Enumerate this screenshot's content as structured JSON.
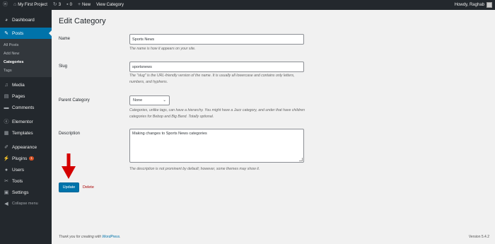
{
  "adminbar": {
    "site_name": "My First Project",
    "updates_count": "3",
    "comments_count": "0",
    "new_label": "New",
    "view_category": "View Category",
    "howdy": "Howdy, Raghab"
  },
  "sidebar": {
    "dashboard": "Dashboard",
    "posts": "Posts",
    "posts_sub": [
      "All Posts",
      "Add New",
      "Categories",
      "Tags"
    ],
    "media": "Media",
    "pages": "Pages",
    "comments": "Comments",
    "elementor": "Elementor",
    "templates": "Templates",
    "appearance": "Appearance",
    "plugins": "Plugins",
    "plugins_badge": "1",
    "users": "Users",
    "tools": "Tools",
    "settings": "Settings",
    "collapse": "Collapse menu"
  },
  "page": {
    "title": "Edit Category"
  },
  "form": {
    "name_label": "Name",
    "name_value": "Sports News",
    "name_desc": "The name is how it appears on your site.",
    "slug_label": "Slug",
    "slug_value": "sportsnews",
    "slug_desc": "The \"slug\" is the URL-friendly version of the name. It is usually all lowercase and contains only letters, numbers, and hyphens.",
    "parent_label": "Parent Category",
    "parent_value": "None",
    "parent_desc": "Categories, unlike tags, can have a hierarchy. You might have a Jazz category, and under that have children categories for Bebop and Big Band. Totally optional.",
    "description_label": "Description",
    "description_value": "Making changes to Sports News categories",
    "description_desc": "The description is not prominent by default; however, some themes may show it.",
    "update_label": "Update",
    "delete_label": "Delete"
  },
  "footer": {
    "thanks_prefix": "Thank you for creating with ",
    "thanks_link": "WordPress",
    "thanks_suffix": ".",
    "version": "Version 5.4.2"
  },
  "colors": {
    "admin_bg": "#23282d",
    "accent": "#0073aa",
    "arrow": "#d40000",
    "delete": "#aa0000"
  }
}
